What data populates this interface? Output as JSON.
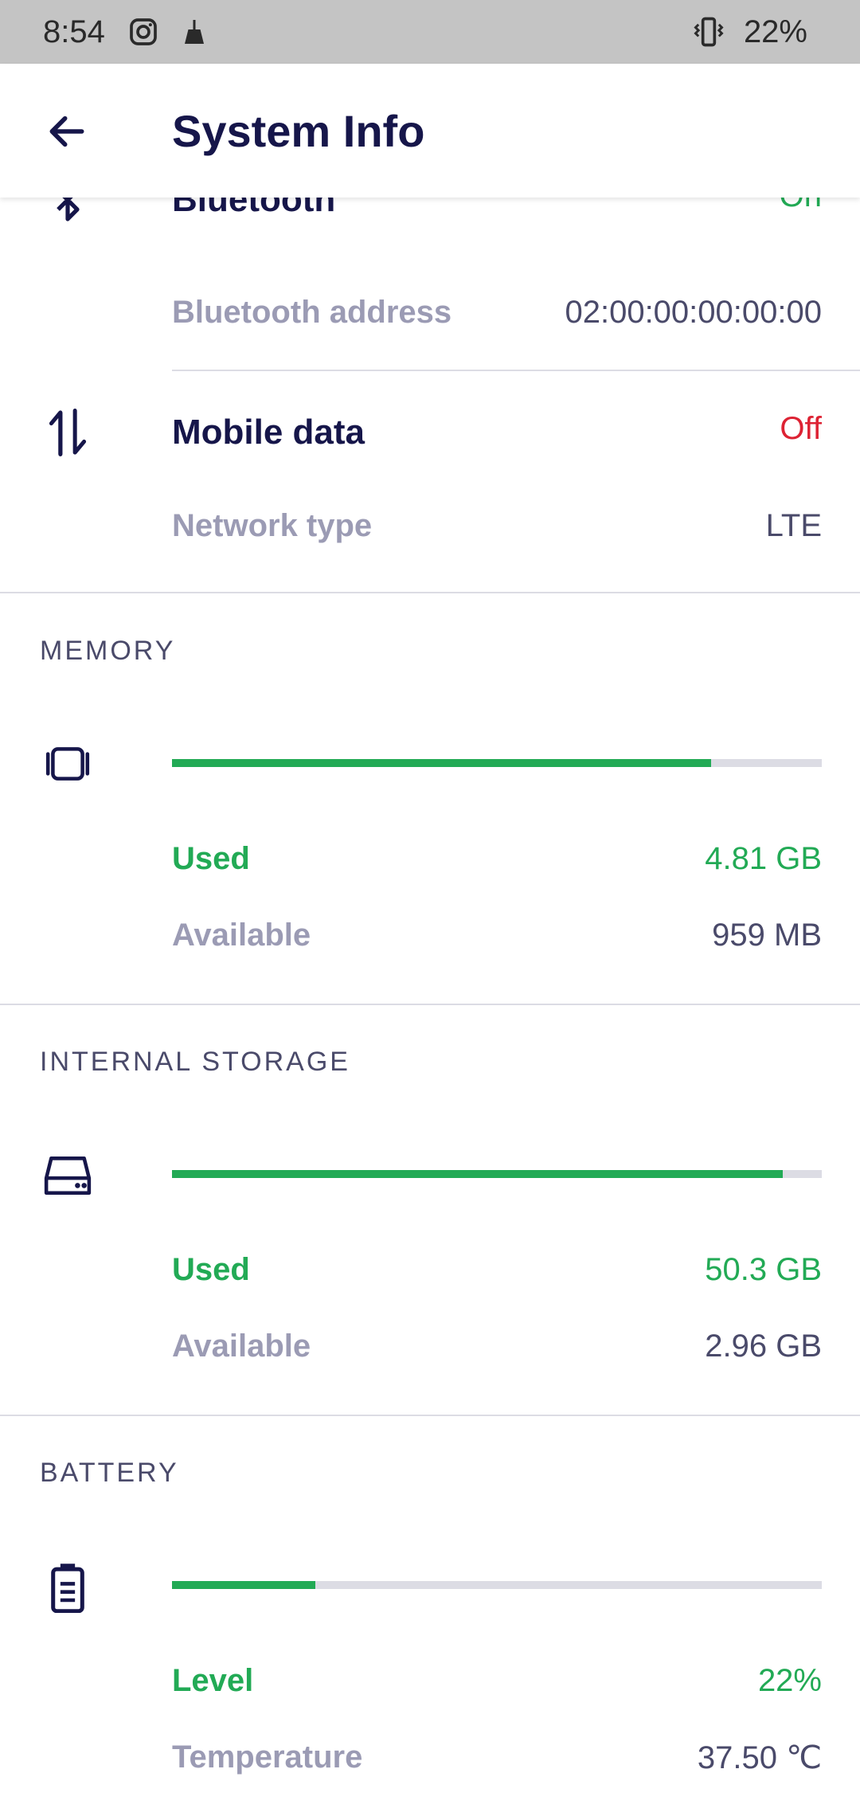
{
  "status_bar": {
    "time": "8:54",
    "battery_percent": "22%",
    "icons": [
      "instagram-icon",
      "broom-icon",
      "vibrate-icon"
    ]
  },
  "app_bar": {
    "title": "System Info",
    "back_icon": "arrow-left-icon"
  },
  "network": {
    "bluetooth": {
      "title": "Bluetooth",
      "status": "On",
      "address_label": "Bluetooth address",
      "address_value": "02:00:00:00:00:00"
    },
    "mobile_data": {
      "title": "Mobile data",
      "status": "Off",
      "network_type_label": "Network type",
      "network_type_value": "LTE"
    }
  },
  "memory": {
    "header": "MEMORY",
    "used_fraction": 0.83,
    "used_label": "Used",
    "used_value": "4.81 GB",
    "available_label": "Available",
    "available_value": "959 MB"
  },
  "storage": {
    "header": "INTERNAL STORAGE",
    "used_fraction": 0.94,
    "used_label": "Used",
    "used_value": "50.3 GB",
    "available_label": "Available",
    "available_value": "2.96 GB"
  },
  "battery": {
    "header": "BATTERY",
    "level_fraction": 0.22,
    "level_label": "Level",
    "level_value": "22%",
    "temperature_label": "Temperature",
    "temperature_value": "37.50 ℃"
  },
  "colors": {
    "title": "#16164a",
    "green": "#22aa55",
    "red": "#dd2233",
    "muted": "#9b9bb4",
    "track": "#dcdce4"
  }
}
